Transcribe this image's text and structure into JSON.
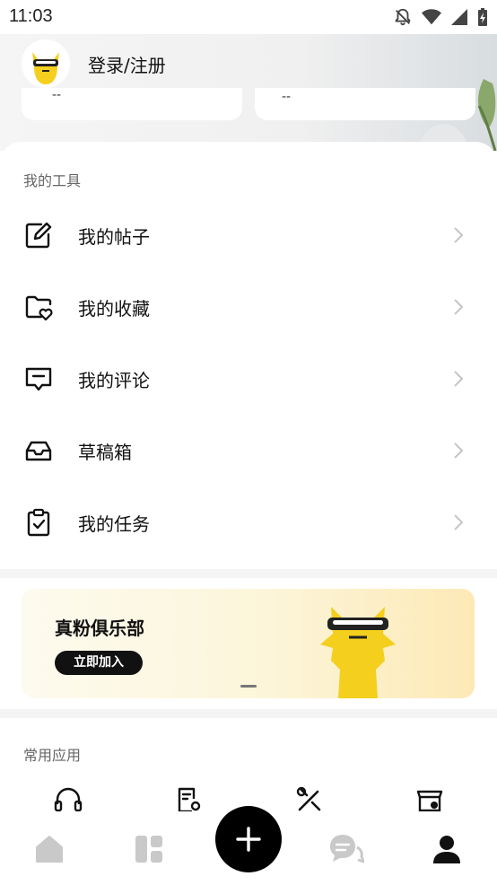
{
  "status_bar": {
    "time": "11:03",
    "icons": [
      "bell-off-icon",
      "wifi-icon",
      "signal-icon",
      "battery-charging-icon"
    ]
  },
  "profile": {
    "login_label": "登录/注册",
    "stats": [
      "--",
      "--"
    ]
  },
  "tools": {
    "title": "我的工具",
    "items": [
      {
        "label": "我的帖子",
        "icon": "edit-post-icon"
      },
      {
        "label": "我的收藏",
        "icon": "favorites-folder-icon"
      },
      {
        "label": "我的评论",
        "icon": "comment-icon"
      },
      {
        "label": "草稿箱",
        "icon": "inbox-drafts-icon"
      },
      {
        "label": "我的任务",
        "icon": "task-clipboard-icon"
      }
    ]
  },
  "banner": {
    "title": "真粉俱乐部",
    "button_label": "立即加入"
  },
  "apps": {
    "title": "常用应用",
    "icons": [
      "headset-icon",
      "document-search-icon",
      "tools-icon",
      "store-icon"
    ]
  },
  "bottom_nav": {
    "items": [
      "home-icon",
      "grid-icon",
      "plus-icon",
      "messages-icon",
      "profile-icon"
    ],
    "active": "profile-icon"
  },
  "colors": {
    "accent": "#000000",
    "mascot_yellow": "#f5cf1e",
    "inactive_nav": "#c9c9c9"
  }
}
